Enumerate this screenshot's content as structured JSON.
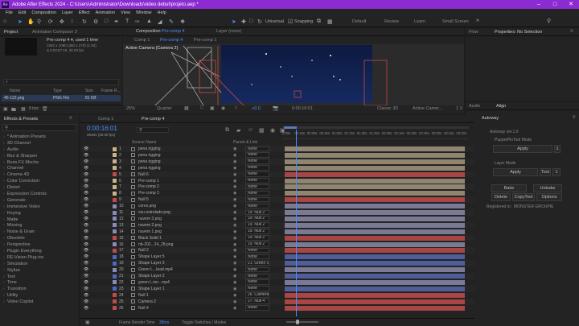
{
  "app": {
    "title": "Adobe After Effects 2024 - C:\\Users\\Administrator\\Downloads\\video debut\\projeto.aep *",
    "icon_text": "Ae",
    "accent": "#8c2bd1"
  },
  "menu": [
    "File",
    "Edit",
    "Composition",
    "Layer",
    "Effect",
    "Animation",
    "View",
    "Window",
    "Help"
  ],
  "toolbar": {
    "universal": "Universal",
    "snapping": "Snapping"
  },
  "workspaces": [
    "Default",
    "Review",
    "Learn",
    "Small Screen"
  ],
  "project": {
    "tab": "Project",
    "tab2": "Animation Composer 3",
    "comp_name": "Pre-comp 4 ▾, used 1 time",
    "comp_info1": "1920 x 1080  (480 x 270) (1.00)",
    "comp_info2": "Δ 0:03:57:16, 30.00 fps",
    "search_icon": "⌕",
    "col_name": "Name",
    "col_type": "Type",
    "col_size": "Size",
    "col_frame": "Frame R...",
    "file_name": "45-122.png",
    "file_type": "PNG File",
    "file_size": "81 KB",
    "bpc": "8 bpc"
  },
  "effects": {
    "title": "Effects & Presets",
    "items": [
      "* Animation Presets",
      "3D Channel",
      "Audio",
      "Blur & Sharpen",
      "Boris FX Mocha",
      "Channel",
      "Cinema 4D",
      "Color Correction",
      "Distort",
      "Expression Controls",
      "Generate",
      "Immersive Video",
      "Keying",
      "Matte",
      "Missing",
      "Noise & Grain",
      "Obsolete",
      "Perspective",
      "Plugin Everything",
      "RE:Vision Plug-ins",
      "Simulation",
      "Stylize",
      "Text",
      "Time",
      "Transition",
      "Utility",
      "Video Copilot"
    ]
  },
  "viewer": {
    "tab_comp": "Composition",
    "tab_comp_name": "Pre-comp 4",
    "tab_layer": "Layer",
    "layer_none": "(none)",
    "crumbs": [
      "Comp 1",
      "Pre-comp 4",
      "Pre-comp 1"
    ],
    "camera_label": "Active Camera (Camera 2)",
    "zoom": "25%",
    "quality": "Quarter",
    "exposure": "+0.0",
    "timecode": "0:00:16:01",
    "renderer": "Classic 3D",
    "camera": "Active Camer...",
    "views": "1 V"
  },
  "right": {
    "flow": "Flow",
    "properties": "Properties: No Selection",
    "audio": "Audio",
    "align": "Align",
    "autoway": "Autoway",
    "version": "Autoway ver.1.9",
    "puppet_mode": "PuppetPinTool Mode",
    "apply": "Apply",
    "layer_mode": "Layer Mode",
    "tool": "Tool",
    "bake": "Bake",
    "unbake": "Unbake",
    "delete": "Delete",
    "copytool": "CopyTool",
    "options": "Options",
    "registered": "Registered to:",
    "reg_name": "MONSTER GROUPIE",
    "one": "1"
  },
  "timeline": {
    "tabs": [
      "Comp 1",
      "Pre-comp 4"
    ],
    "timecode": "0:00:16:01",
    "frames": "00481 (30.00 fps)",
    "col_source": "Source Name",
    "col_parent": "Parent & Link",
    "ruler": [
      "0:00s",
      "00:15s",
      "00:30s",
      "00:45s",
      "01:00s",
      "01:15s",
      "01:30s",
      "01:45s",
      "02:00s",
      "02:15s",
      "02:30s",
      "02:45s",
      "03:00s",
      "03:15s",
      "03:30s"
    ],
    "frame_render": "Frame Render Time",
    "render_ms": "28ms",
    "toggle": "Toggle Switches / Modes",
    "layers": [
      {
        "n": "1",
        "name": "pena rigging",
        "c": "#c9b48a",
        "parent": "None"
      },
      {
        "n": "2",
        "name": "pena rigging",
        "c": "#c9b48a",
        "parent": "None"
      },
      {
        "n": "3",
        "name": "pena rigging",
        "c": "#c9b48a",
        "parent": "None"
      },
      {
        "n": "4",
        "name": "pena rigging",
        "c": "#c9b48a",
        "parent": "None"
      },
      {
        "n": "5",
        "name": "Null 6",
        "c": "#c44a4a",
        "parent": "None"
      },
      {
        "n": "6",
        "name": "Pre-comp 1",
        "c": "#c9b48a",
        "parent": "None"
      },
      {
        "n": "7",
        "name": "Pre-comp 2",
        "c": "#c9b48a",
        "parent": "None"
      },
      {
        "n": "8",
        "name": "Pre-comp 3",
        "c": "#c9b48a",
        "parent": "None"
      },
      {
        "n": "9",
        "name": "Null 5",
        "c": "#c44a4a",
        "parent": "None"
      },
      {
        "n": "10",
        "name": "cores.png",
        "c": "#8a8ab8",
        "parent": "None"
      },
      {
        "n": "11",
        "name": "ceu estrelado.png",
        "c": "#8a8ab8",
        "parent": "19. Null 2"
      },
      {
        "n": "12",
        "name": "nuvem 3.png",
        "c": "#8a8ab8",
        "parent": "19. Null 2"
      },
      {
        "n": "13",
        "name": "nuvem 2.png",
        "c": "#8a8ab8",
        "parent": "19. Null 2"
      },
      {
        "n": "14",
        "name": "nuvem 1.png",
        "c": "#8a8ab8",
        "parent": "19. Null 2"
      },
      {
        "n": "15",
        "name": "Black Solid 1",
        "c": "#c44a4a",
        "parent": "19. Null 2"
      },
      {
        "n": "16",
        "name": "nb-202...24_28.png",
        "c": "#8a8ab8",
        "parent": "19. Null 2"
      },
      {
        "n": "17",
        "name": "Null 2",
        "c": "#c44a4a",
        "parent": "None"
      },
      {
        "n": "18",
        "name": "Shape Layer 5",
        "c": "#4a6ac4",
        "parent": "None"
      },
      {
        "n": "19",
        "name": "Shape Layer 3",
        "c": "#4a6ac4",
        "parent": "21. Green Scr"
      },
      {
        "n": "20",
        "name": "Green L...lead.mp4",
        "c": "#8a8ab8",
        "parent": "None"
      },
      {
        "n": "21",
        "name": "Shape Layer 2",
        "c": "#4a6ac4",
        "parent": "None"
      },
      {
        "n": "22",
        "name": "green L.ion...mp4",
        "c": "#8a8ab8",
        "parent": "None"
      },
      {
        "n": "23",
        "name": "Shape Layer 1",
        "c": "#4a6ac4",
        "parent": "None"
      },
      {
        "n": "24",
        "name": "Null 1",
        "c": "#c44a4a",
        "parent": "26. Camera 2"
      },
      {
        "n": "25",
        "name": "Camera 2",
        "c": "#c44a4a",
        "parent": "27. Null 4"
      },
      {
        "n": "26",
        "name": "Null 4",
        "c": "#c44a4a",
        "parent": "None"
      }
    ]
  }
}
